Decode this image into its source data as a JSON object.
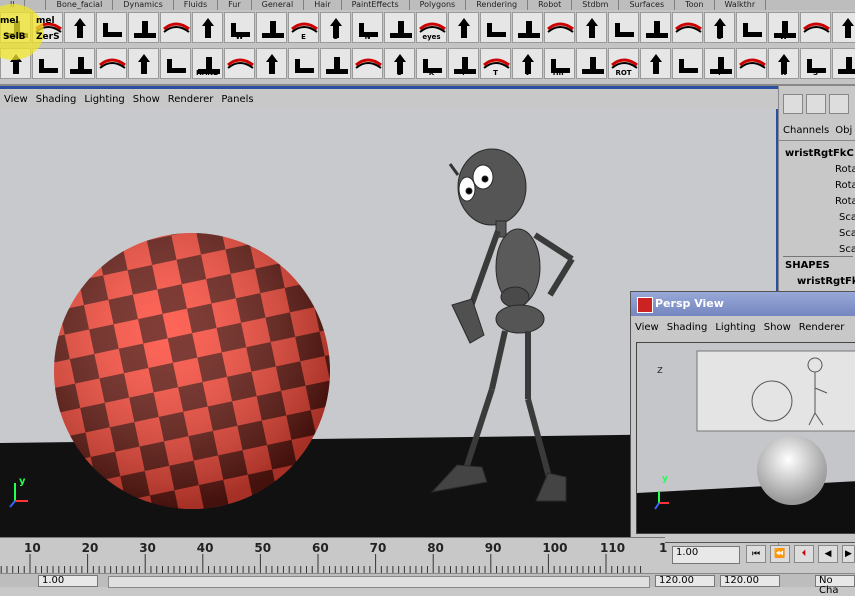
{
  "shelf": {
    "tabs": [
      "ll",
      "",
      "Bone_facial",
      "Dynamics",
      "Fluids",
      "Fur",
      "General",
      "Hair",
      "PaintEffects",
      "Polygons",
      "Rendering",
      "Robot",
      "Stdbm",
      "Surfaces",
      "Toon",
      "Walkthr"
    ],
    "row1": [
      "",
      "",
      "",
      "",
      "",
      "",
      "",
      "W",
      "",
      "E",
      "U",
      "N",
      "",
      "eyes",
      "",
      "",
      "",
      "",
      "",
      "",
      "",
      "",
      "U",
      "",
      "W",
      "",
      ""
    ],
    "row2": [
      "",
      "",
      "",
      "",
      "",
      "",
      "HAND",
      "",
      "",
      "",
      "",
      "",
      "S",
      "K",
      "i",
      "T",
      "V",
      "HIP",
      "",
      "ROT",
      "",
      "",
      "i",
      "",
      "K",
      "S",
      "",
      ""
    ],
    "highlight_labels": [
      "mel",
      "mel",
      "SelB",
      "ZerS"
    ]
  },
  "viewport": {
    "menu": [
      "View",
      "Shading",
      "Lighting",
      "Show",
      "Renderer",
      "Panels"
    ],
    "axis_label": "y"
  },
  "channel_box": {
    "tabs": [
      "Channels",
      "Obj"
    ],
    "node": "wristRgtFkC",
    "attrs": [
      "Rota",
      "Rota",
      "Rota",
      "Sca",
      "Sca",
      "Sca"
    ],
    "shapes_label": "SHAPES",
    "shape_node": "wristRgtFk"
  },
  "persp_window": {
    "title": "Persp View",
    "menu": [
      "View",
      "Shading",
      "Lighting",
      "Show",
      "Renderer"
    ],
    "axis_label": "y"
  },
  "timeline": {
    "ticks": [
      "10",
      "20",
      "30",
      "40",
      "50",
      "60",
      "70",
      "80",
      "90",
      "100",
      "110",
      "1"
    ],
    "current_frame": "1.00",
    "range_start": "1.00",
    "range_end_a": "120.00",
    "range_end_b": "120.00",
    "no_character": "No Cha"
  },
  "colors": {
    "accent": "#2b4fa0",
    "sphere_red": "#ff4a3a",
    "sphere_dark": "#6a1a12"
  }
}
